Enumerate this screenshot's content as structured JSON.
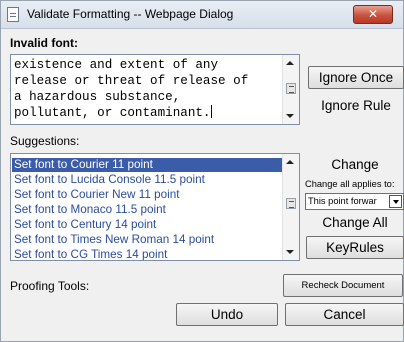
{
  "window": {
    "title": "Validate Formatting -- Webpage Dialog",
    "close_label": "✕"
  },
  "invalid_font": {
    "heading": "Invalid font:",
    "lines": [
      "existence and extent of any",
      "release or threat of release of",
      "a hazardous substance,",
      "pollutant, or contaminant."
    ]
  },
  "suggestions": {
    "heading": "Suggestions:",
    "items": [
      "Set font to Courier 11 point",
      "Set font to Lucida Console 11.5 point",
      "Set font to Courier New 11 point",
      "Set font to Monaco 11.5 point",
      "Set font to Century 14 point",
      "Set font to Times New Roman 14 point",
      "Set font to CG Times 14 point"
    ],
    "selected_index": 0
  },
  "buttons": {
    "ignore_once": "Ignore Once",
    "ignore_rule": "Ignore Rule",
    "change": "Change",
    "change_all_applies_label": "Change all applies to:",
    "change_all_applies_value": "This point forwar",
    "change_all": "Change All",
    "keyrules": "KeyRules",
    "recheck": "Recheck Document",
    "undo": "Undo",
    "cancel": "Cancel"
  },
  "proofing": {
    "heading": "Proofing Tools:"
  },
  "colors": {
    "selection": "#3b5ca8",
    "list_text": "#2b4c9f",
    "close_button": "#c9523e"
  }
}
